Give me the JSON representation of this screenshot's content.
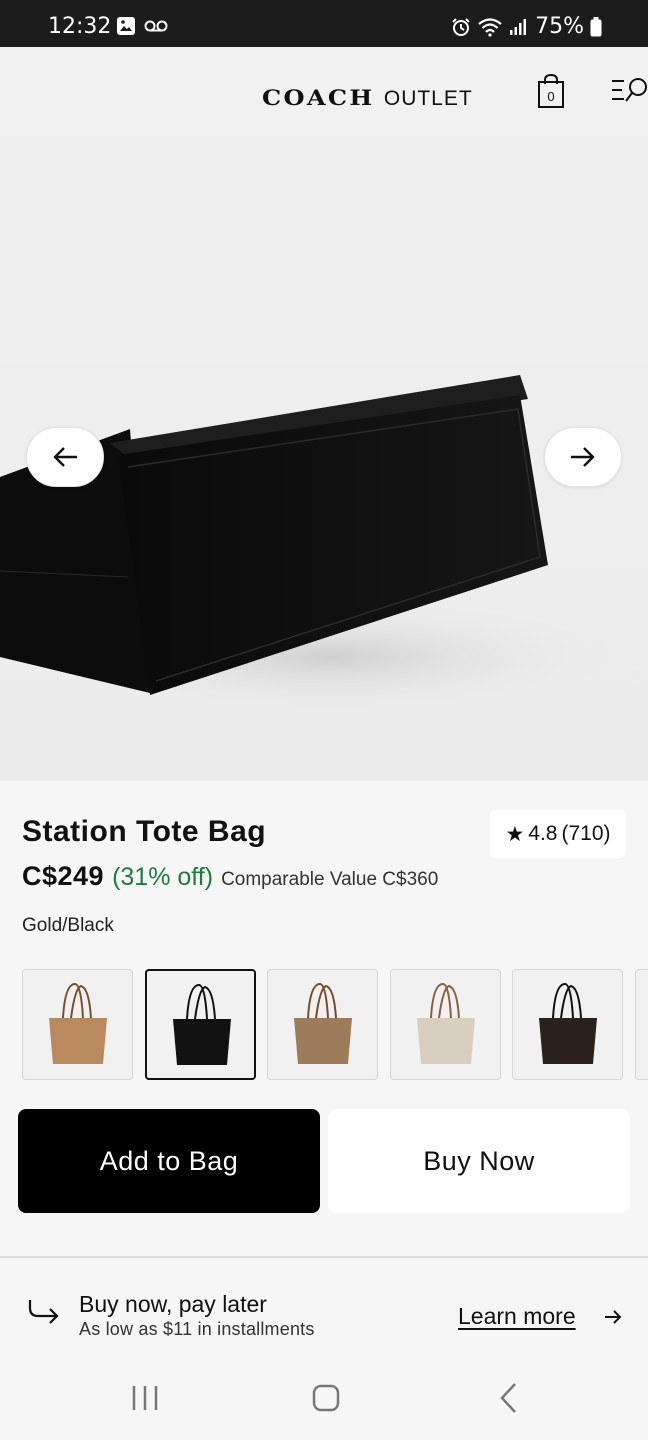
{
  "status_bar": {
    "time": "12:32",
    "battery": "75%",
    "icons": [
      "image-icon",
      "voicemail-icon",
      "alarm-icon",
      "wifi-icon",
      "signal-icon",
      "battery-icon"
    ]
  },
  "header": {
    "logo_coach": "COACH",
    "logo_outlet": "OUTLET",
    "bag_count": "0",
    "icons": [
      "shopping-bag-icon",
      "menu-search-icon"
    ]
  },
  "gallery": {
    "prev_icon": "arrow-left-icon",
    "next_icon": "arrow-right-icon"
  },
  "product": {
    "title": "Station Tote Bag",
    "rating_value": "4.8",
    "rating_count": "(710)",
    "price": "C$249",
    "discount": "(31% off)",
    "comparable_label": "Comparable Value C$360",
    "selected_color": "Gold/Black",
    "swatches": [
      {
        "name": "tan",
        "color": "#b98a5e",
        "handle": "#7a5030",
        "selected": false
      },
      {
        "name": "black",
        "color": "#121212",
        "handle": "#111111",
        "selected": true
      },
      {
        "name": "signature-khaki",
        "color": "#9d7c5c",
        "handle": "#7a4a2a",
        "selected": false
      },
      {
        "name": "signature-chalk",
        "color": "#d9cfc0",
        "handle": "#8a6040",
        "selected": false
      },
      {
        "name": "signature-brown-black",
        "color": "#2a211d",
        "handle": "#111111",
        "selected": false
      }
    ],
    "add_to_bag": "Add to Bag",
    "buy_now": "Buy Now"
  },
  "bnpl": {
    "title": "Buy now, pay later",
    "subtitle": "As low as $11 in installments",
    "learn_more": "Learn more"
  },
  "colors": {
    "discount_green": "#1f7a3c",
    "primary_black": "#000000"
  }
}
